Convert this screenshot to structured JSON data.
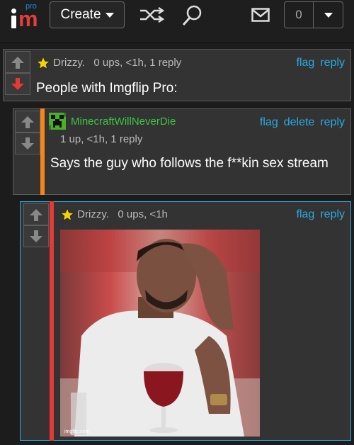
{
  "header": {
    "logo_small": "pro",
    "create_label": "Create",
    "notification_count": "0"
  },
  "comments": [
    {
      "author": "Drizzy.",
      "stats": "0 ups, <1h, 1 reply",
      "actions": [
        "flag",
        "reply"
      ],
      "text": "People with Imgflip Pro:",
      "vote_state": "downvoted"
    },
    {
      "author": "MinecraftWillNeverDie",
      "stats": "1 up, <1h, 1 reply",
      "actions": [
        "flag",
        "delete",
        "reply"
      ],
      "text": "Says the guy who follows the f**kin sex stream",
      "author_color": "#3cc443",
      "stripe_color": "#f5841f"
    },
    {
      "author": "Drizzy.",
      "stats": "0 ups, <1h",
      "actions": [
        "flag",
        "reply"
      ],
      "image_watermark": "imgflip.com",
      "stripe_color": "#e53935",
      "border_color": "#29a9e1"
    }
  ],
  "colors": {
    "link": "#29a9e1",
    "star": "#f5d300",
    "downvote_active": "#e53935"
  }
}
